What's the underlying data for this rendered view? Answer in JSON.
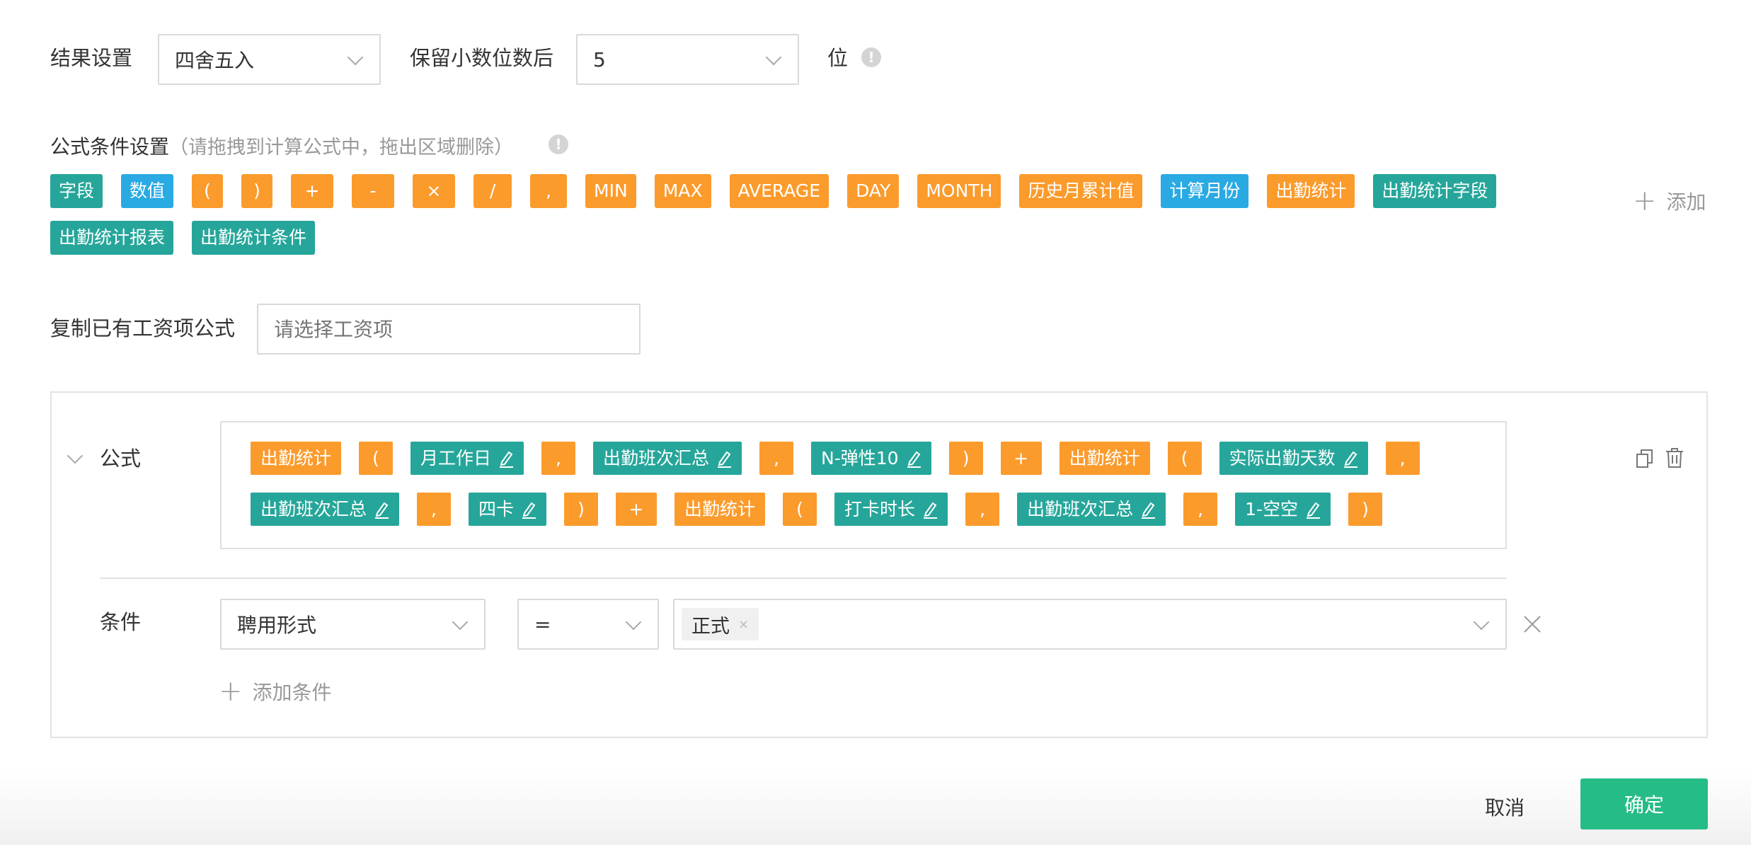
{
  "result": {
    "label": "结果设置",
    "rounding_value": "四舍五入",
    "decimals_label": "保留小数位数后",
    "decimals_value": "5",
    "unit": "位",
    "info_glyph": "!"
  },
  "conditions_palette": {
    "title": "公式条件设置",
    "hint": "（请拖拽到计算公式中，拖出区域删除）",
    "info_glyph": "!",
    "chips": [
      {
        "label": "字段",
        "color": "teal"
      },
      {
        "label": "数值",
        "color": "blue"
      },
      {
        "label": "(",
        "color": "orange"
      },
      {
        "label": ")",
        "color": "orange"
      },
      {
        "label": "+",
        "color": "orange"
      },
      {
        "label": "-",
        "color": "orange"
      },
      {
        "label": "×",
        "color": "orange"
      },
      {
        "label": "/",
        "color": "orange"
      },
      {
        "label": ",",
        "color": "orange"
      },
      {
        "label": "MIN",
        "color": "orange"
      },
      {
        "label": "MAX",
        "color": "orange"
      },
      {
        "label": "AVERAGE",
        "color": "orange"
      },
      {
        "label": "DAY",
        "color": "orange"
      },
      {
        "label": "MONTH",
        "color": "orange"
      },
      {
        "label": "历史月累计值",
        "color": "orange"
      },
      {
        "label": "计算月份",
        "color": "blue"
      },
      {
        "label": "出勤统计",
        "color": "orange"
      },
      {
        "label": "出勤统计字段",
        "color": "teal"
      },
      {
        "label": "出勤统计报表",
        "color": "teal"
      },
      {
        "label": "出勤统计条件",
        "color": "teal"
      }
    ],
    "add_label": "添加"
  },
  "copy": {
    "label": "复制已有工资项公式",
    "placeholder": "请选择工资项"
  },
  "formula": {
    "label": "公式",
    "tokens": [
      {
        "label": "出勤统计",
        "color": "orange",
        "editable": false
      },
      {
        "label": "(",
        "color": "orange",
        "editable": false
      },
      {
        "label": "月工作日",
        "color": "teal",
        "editable": true
      },
      {
        "label": ",",
        "color": "orange",
        "editable": false
      },
      {
        "label": "出勤班次汇总",
        "color": "teal",
        "editable": true
      },
      {
        "label": ",",
        "color": "orange",
        "editable": false
      },
      {
        "label": "N-弹性10",
        "color": "teal",
        "editable": true
      },
      {
        "label": ")",
        "color": "orange",
        "editable": false
      },
      {
        "label": "+",
        "color": "orange",
        "editable": false
      },
      {
        "label": "出勤统计",
        "color": "orange",
        "editable": false
      },
      {
        "label": "(",
        "color": "orange",
        "editable": false
      },
      {
        "label": "实际出勤天数",
        "color": "teal",
        "editable": true
      },
      {
        "label": ",",
        "color": "orange",
        "editable": false
      },
      {
        "label": "出勤班次汇总",
        "color": "teal",
        "editable": true
      },
      {
        "label": ",",
        "color": "orange",
        "editable": false
      },
      {
        "label": "四卡",
        "color": "teal",
        "editable": true
      },
      {
        "label": ")",
        "color": "orange",
        "editable": false
      },
      {
        "label": "+",
        "color": "orange",
        "editable": false
      },
      {
        "label": "出勤统计",
        "color": "orange",
        "editable": false
      },
      {
        "label": "(",
        "color": "orange",
        "editable": false
      },
      {
        "label": "打卡时长",
        "color": "teal",
        "editable": true
      },
      {
        "label": ",",
        "color": "orange",
        "editable": false
      },
      {
        "label": "出勤班次汇总",
        "color": "teal",
        "editable": true
      },
      {
        "label": ",",
        "color": "orange",
        "editable": false
      },
      {
        "label": "1-空空",
        "color": "teal",
        "editable": true
      },
      {
        "label": ")",
        "color": "orange",
        "editable": false
      }
    ]
  },
  "condition": {
    "label": "条件",
    "field": "聘用形式",
    "operator": "=",
    "value_tag": "正式",
    "tag_remove_glyph": "×",
    "add_label": "添加条件"
  },
  "footer": {
    "cancel": "取消",
    "confirm": "确定"
  },
  "colors": {
    "teal": "#26a69a",
    "blue": "#29aae3",
    "orange": "#fb9b2c",
    "confirm": "#26bc86"
  }
}
